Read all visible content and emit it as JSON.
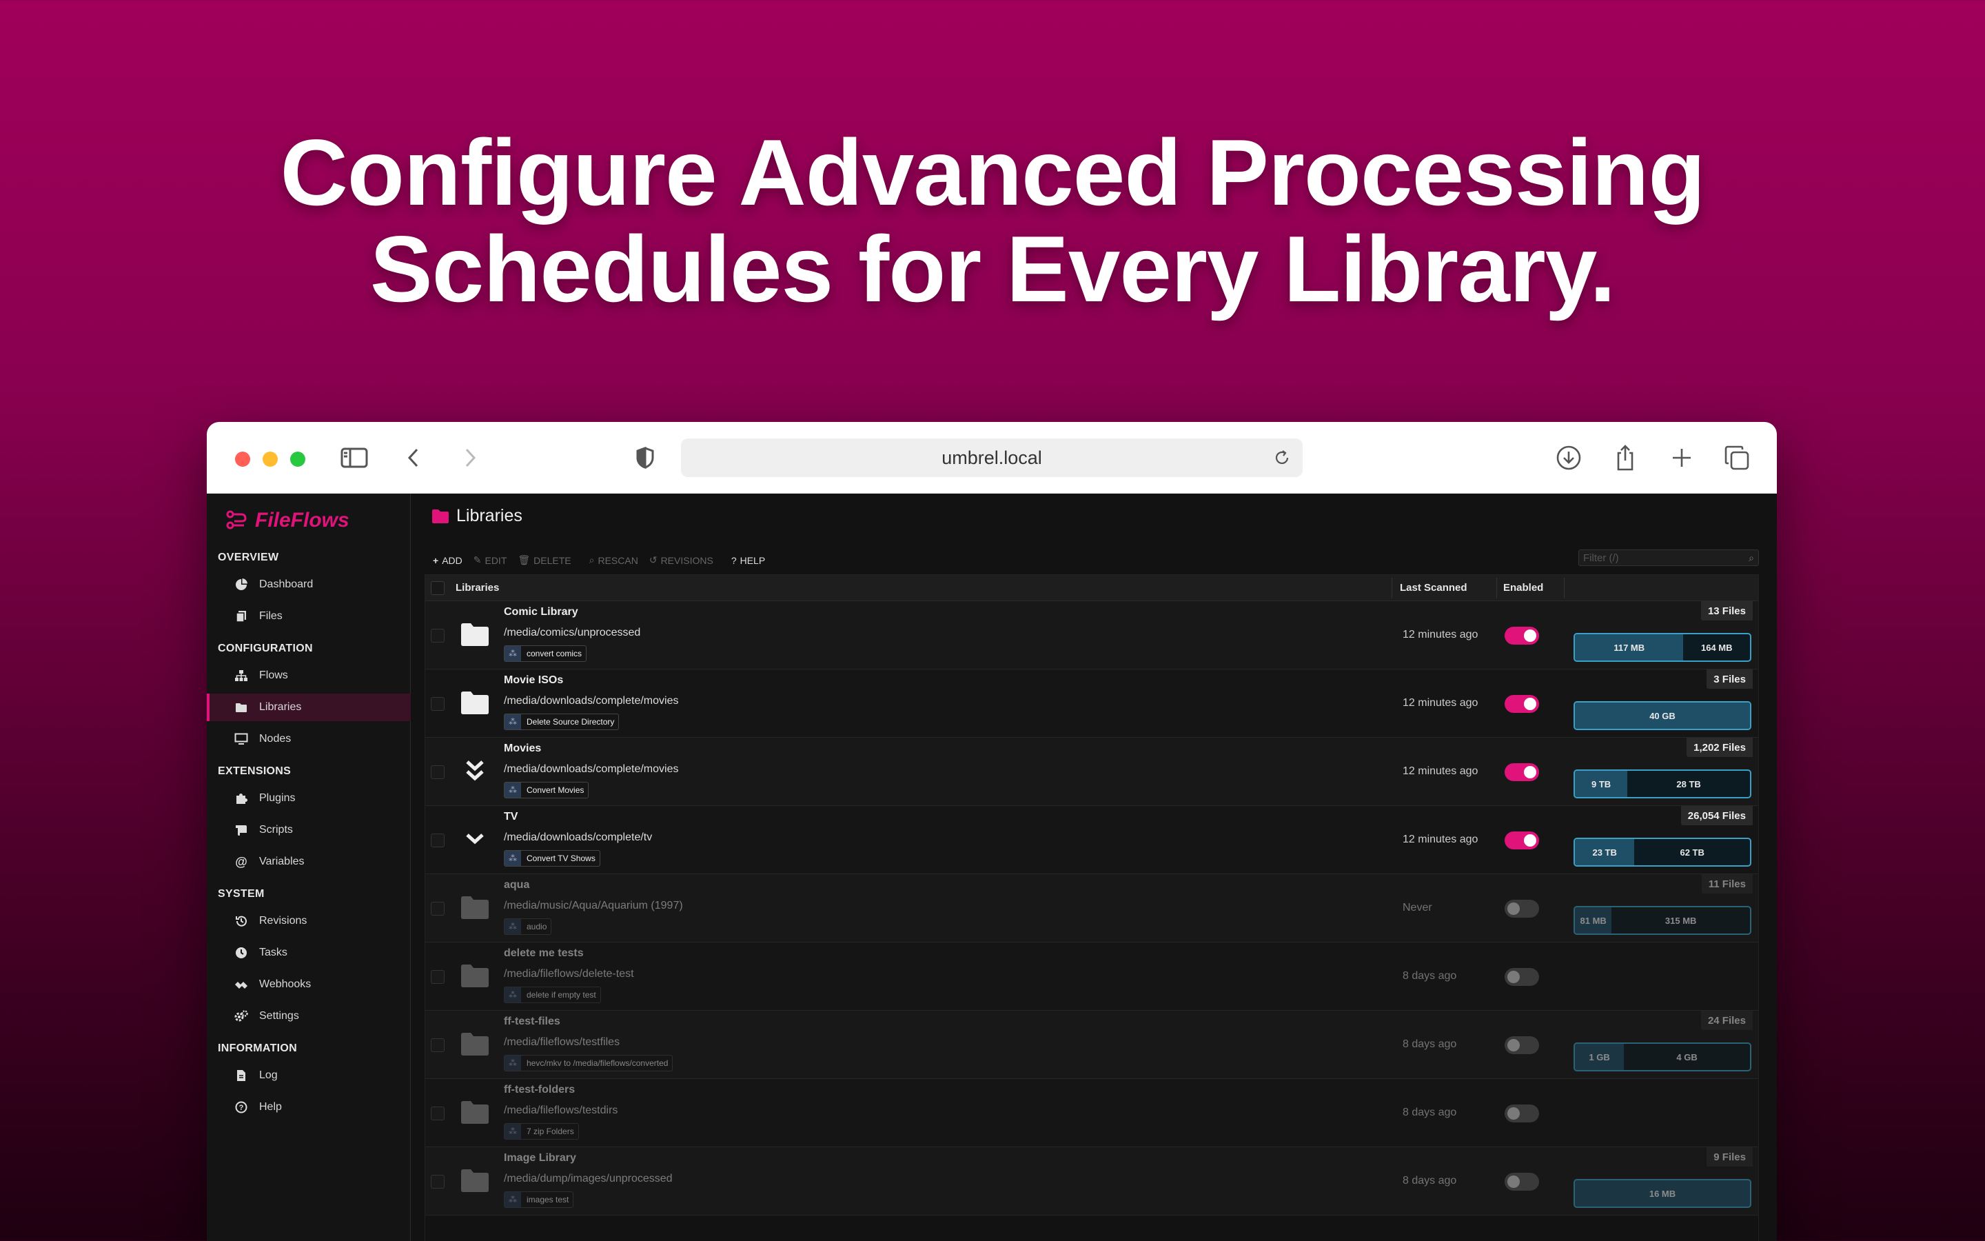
{
  "headline": {
    "line1": "Configure Advanced Processing",
    "line2": "Schedules for Every Library."
  },
  "browser": {
    "url": "umbrel.local",
    "icons": [
      "sidebar-toggle-icon",
      "back-icon",
      "forward-icon",
      "shield-icon",
      "reload-icon",
      "download-icon",
      "share-icon",
      "new-tab-icon",
      "tabs-overview-icon"
    ]
  },
  "app": {
    "brand": "FileFlows",
    "accent": "#e0137a",
    "sidebar": {
      "sections": [
        {
          "title": "OVERVIEW",
          "items": [
            {
              "label": "Dashboard",
              "icon": "dashboard-icon"
            },
            {
              "label": "Files",
              "icon": "files-icon"
            }
          ]
        },
        {
          "title": "CONFIGURATION",
          "items": [
            {
              "label": "Flows",
              "icon": "flows-icon"
            },
            {
              "label": "Libraries",
              "icon": "folder-icon",
              "active": true
            },
            {
              "label": "Nodes",
              "icon": "monitor-icon"
            }
          ]
        },
        {
          "title": "EXTENSIONS",
          "items": [
            {
              "label": "Plugins",
              "icon": "puzzle-icon"
            },
            {
              "label": "Scripts",
              "icon": "scroll-icon"
            },
            {
              "label": "Variables",
              "icon": "at-icon"
            }
          ]
        },
        {
          "title": "SYSTEM",
          "items": [
            {
              "label": "Revisions",
              "icon": "history-icon"
            },
            {
              "label": "Tasks",
              "icon": "clock-icon"
            },
            {
              "label": "Webhooks",
              "icon": "webhook-icon"
            },
            {
              "label": "Settings",
              "icon": "gears-icon"
            }
          ]
        },
        {
          "title": "INFORMATION",
          "items": [
            {
              "label": "Log",
              "icon": "log-icon"
            },
            {
              "label": "Help",
              "icon": "help-icon"
            }
          ]
        }
      ]
    },
    "page_title": "Libraries",
    "toolbar": {
      "add": "ADD",
      "edit": "EDIT",
      "delete": "DELETE",
      "rescan": "RESCAN",
      "revisions": "REVISIONS",
      "help": "HELP"
    },
    "filter_placeholder": "Filter (/)",
    "columns": {
      "libraries": "Libraries",
      "last_scanned": "Last Scanned",
      "enabled": "Enabled"
    },
    "rows": [
      {
        "name": "Comic Library",
        "path": "/media/comics/unprocessed",
        "flow": "convert comics",
        "scanned": "12 minutes ago",
        "enabled": true,
        "files": "13 Files",
        "storage": [
          "117 MB",
          "164 MB"
        ],
        "icon": "folder-icon"
      },
      {
        "name": "Movie ISOs",
        "path": "/media/downloads/complete/movies",
        "flow": "Delete Source Directory",
        "scanned": "12 minutes ago",
        "enabled": true,
        "files": "3 Files",
        "storage": [
          "40 GB"
        ],
        "icon": "folder-icon"
      },
      {
        "name": "Movies",
        "path": "/media/downloads/complete/movies",
        "flow": "Convert Movies",
        "scanned": "12 minutes ago",
        "enabled": true,
        "files": "1,202 Files",
        "storage": [
          "9 TB",
          "28 TB"
        ],
        "icon": "double-chevron-down-icon"
      },
      {
        "name": "TV",
        "path": "/media/downloads/complete/tv",
        "flow": "Convert TV Shows",
        "scanned": "12 minutes ago",
        "enabled": true,
        "files": "26,054 Files",
        "storage": [
          "23 TB",
          "62 TB"
        ],
        "icon": "chevron-down-icon"
      },
      {
        "name": "aqua",
        "path": "/media/music/Aqua/Aquarium (1997)",
        "flow": "audio",
        "scanned": "Never",
        "enabled": false,
        "files": "11 Files",
        "storage": [
          "81 MB",
          "315 MB"
        ],
        "icon": "folder-icon"
      },
      {
        "name": "delete me tests",
        "path": "/media/fileflows/delete-test",
        "flow": "delete if empty test",
        "scanned": "8 days ago",
        "enabled": false,
        "files": "",
        "storage": [],
        "icon": "folder-icon"
      },
      {
        "name": "ff-test-files",
        "path": "/media/fileflows/testfiles",
        "flow": "hevc/mkv to /media/fileflows/converted",
        "scanned": "8 days ago",
        "enabled": false,
        "files": "24 Files",
        "storage": [
          "1 GB",
          "4 GB"
        ],
        "icon": "folder-icon"
      },
      {
        "name": "ff-test-folders",
        "path": "/media/fileflows/testdirs",
        "flow": "7 zip Folders",
        "scanned": "8 days ago",
        "enabled": false,
        "files": "",
        "storage": [],
        "icon": "folder-icon"
      },
      {
        "name": "Image Library",
        "path": "/media/dump/images/unprocessed",
        "flow": "images test",
        "scanned": "8 days ago",
        "enabled": false,
        "files": "9 Files",
        "storage": [
          "16 MB"
        ],
        "icon": "folder-icon"
      }
    ]
  }
}
